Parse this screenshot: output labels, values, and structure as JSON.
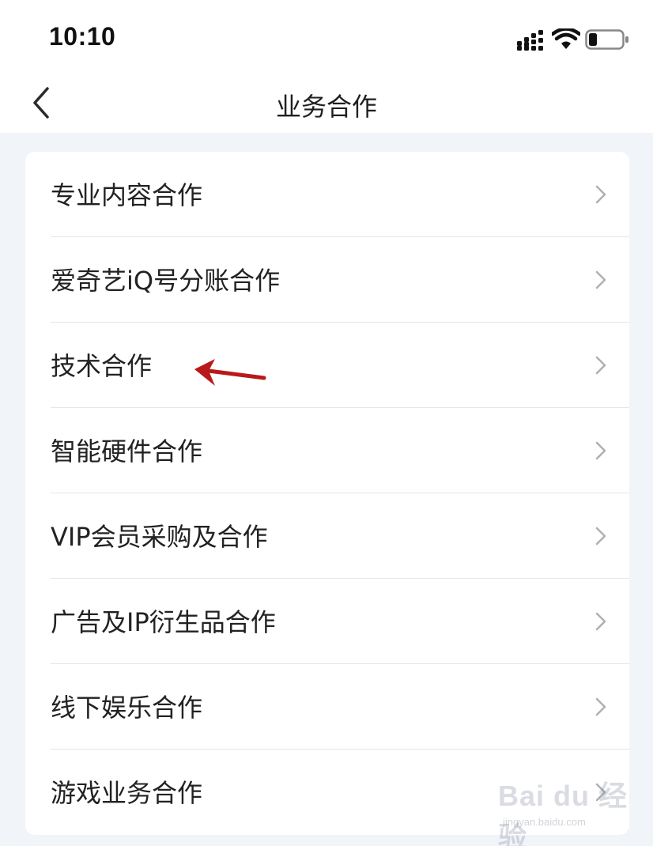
{
  "status_bar": {
    "time": "10:10",
    "icons": [
      "cellular-signal-icon",
      "wifi-icon",
      "battery-icon"
    ]
  },
  "nav": {
    "title": "业务合作",
    "back_icon": "chevron-left-icon"
  },
  "menu": {
    "items": [
      {
        "label": "专业内容合作"
      },
      {
        "label": "爱奇艺iQ号分账合作"
      },
      {
        "label": "技术合作"
      },
      {
        "label": "智能硬件合作"
      },
      {
        "label": "VIP会员采购及合作"
      },
      {
        "label": "广告及IP衍生品合作"
      },
      {
        "label": "线下娱乐合作"
      },
      {
        "label": "游戏业务合作"
      }
    ],
    "chevron_icon": "chevron-right-icon"
  },
  "annotation": {
    "target_item": "技术合作",
    "icon": "red-arrow-icon",
    "color": "#b8191a"
  },
  "watermark": {
    "logo": "Bai du 经验",
    "url": "jingyan.baidu.com"
  },
  "colors": {
    "page_background": "#f1f4f9",
    "card_background": "#ffffff",
    "text": "#222222",
    "chevron": "#b0b0b0"
  }
}
